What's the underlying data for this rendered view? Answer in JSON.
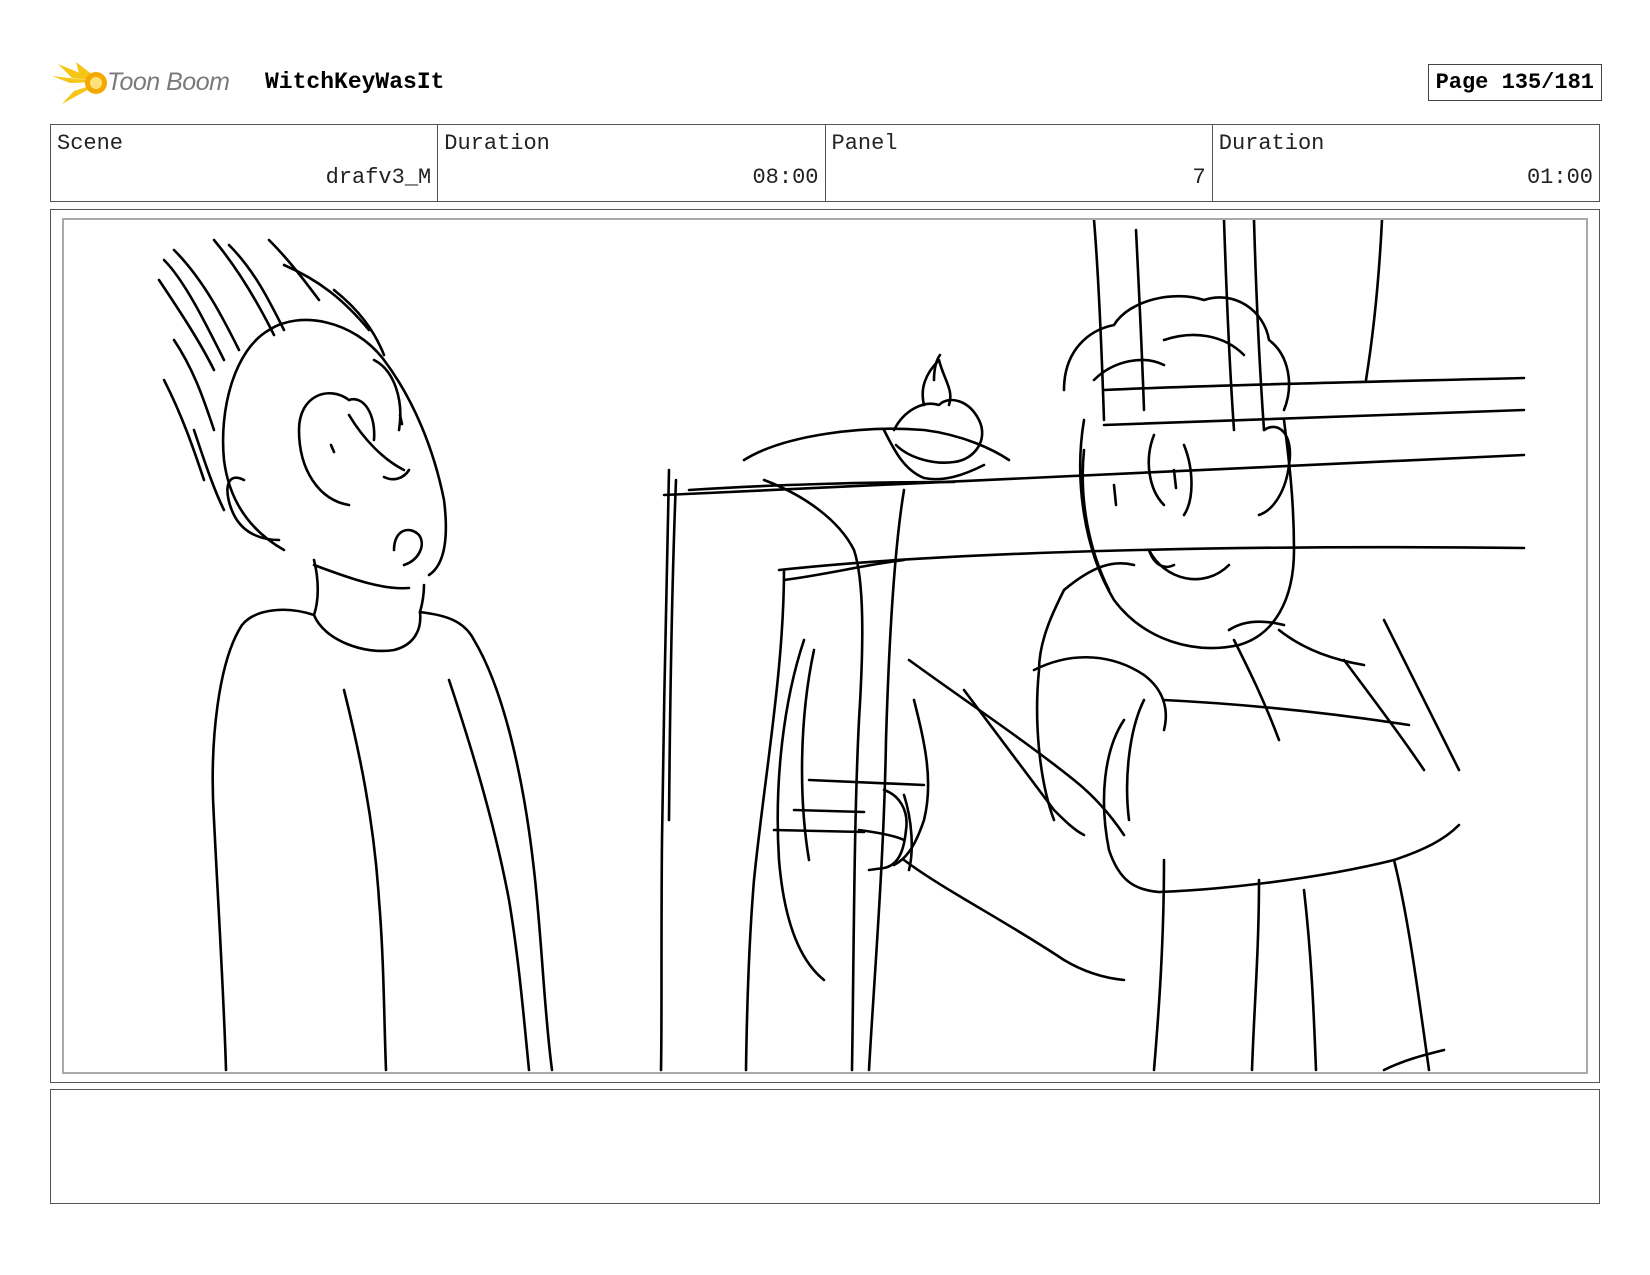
{
  "header": {
    "logo_text": "Toon Boom",
    "project_title": "WitchKeyWasIt",
    "page_label": "Page 135/181"
  },
  "info": {
    "scene_label": "Scene",
    "scene_value": "drafv3_M",
    "scene_duration_label": "Duration",
    "scene_duration_value": "08:00",
    "panel_label": "Panel",
    "panel_value": "7",
    "panel_duration_label": "Duration",
    "panel_duration_value": "01:00"
  },
  "notes": {
    "text": ""
  },
  "colors": {
    "logo_accent": "#f5c518",
    "frame_border": "#555555"
  }
}
